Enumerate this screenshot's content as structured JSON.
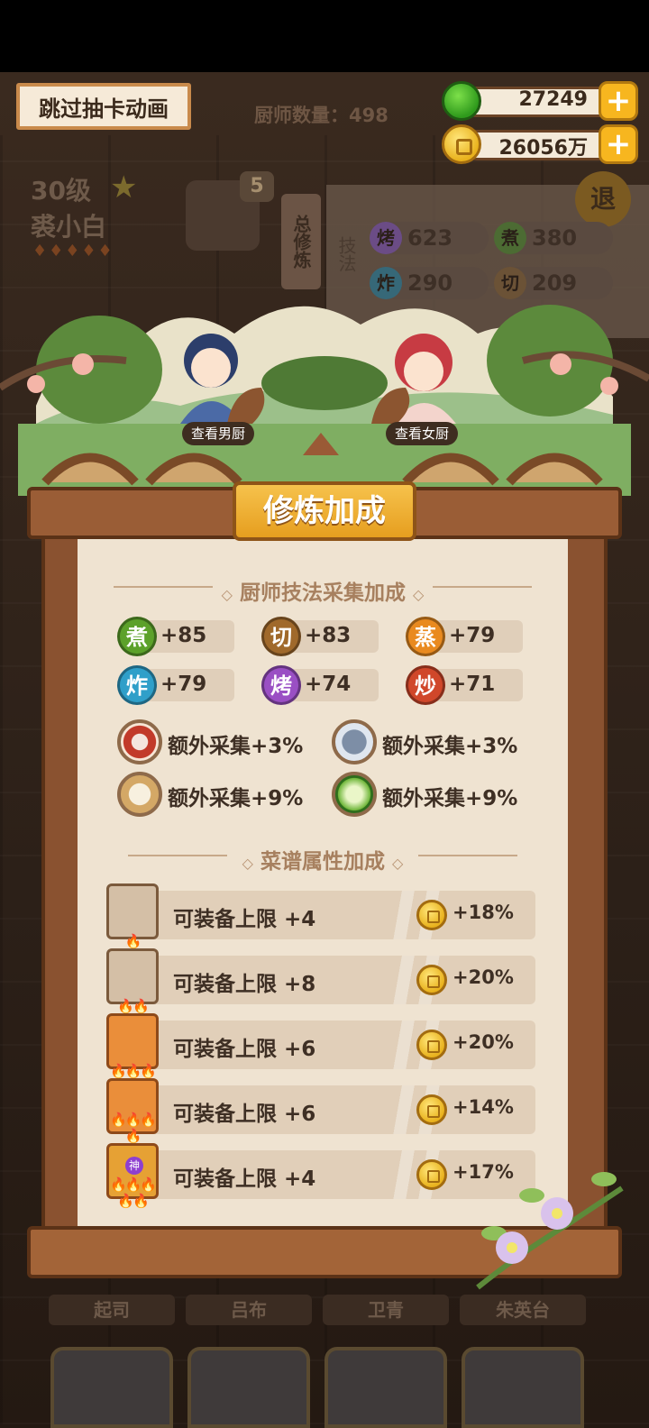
{
  "top": {
    "skip_label": "跳过抽卡动画",
    "chef_count": "厨师数量：498",
    "jade": "27249",
    "coins": "26056万",
    "plus": "+"
  },
  "background": {
    "level": "30级",
    "name": "裘小白",
    "badge": "5",
    "train_label": "总修炼",
    "exit_label": "退",
    "skill_side": "技法",
    "skills": [
      {
        "char": "烤",
        "value": "623"
      },
      {
        "char": "煮",
        "value": "380"
      },
      {
        "char": "炸",
        "value": "290"
      },
      {
        "char": "切",
        "value": "209"
      }
    ],
    "bottom_names": [
      "起司",
      "吕布",
      "卫青",
      "朱英台"
    ]
  },
  "scene": {
    "male_chef_label": "查看男厨",
    "female_chef_label": "查看女厨"
  },
  "board": {
    "title": "修炼加成",
    "skill_section_title": "厨师技法采集加成",
    "skills": [
      {
        "char": "煮",
        "value": "+85",
        "color": "#5ca12a"
      },
      {
        "char": "切",
        "value": "+83",
        "color": "#a0692b"
      },
      {
        "char": "蒸",
        "value": "+79",
        "color": "#e98a1f"
      },
      {
        "char": "炸",
        "value": "+79",
        "color": "#2f9fc9"
      },
      {
        "char": "烤",
        "value": "+74",
        "color": "#9a4fc4"
      },
      {
        "char": "炒",
        "value": "+71",
        "color": "#d0472a"
      }
    ],
    "extras": [
      {
        "icon": "meat-icon",
        "text": "额外采集+3%"
      },
      {
        "icon": "fish-icon",
        "text": "额外采集+3%"
      },
      {
        "icon": "flour-icon",
        "text": "额外采集+9%"
      },
      {
        "icon": "cabbage-icon",
        "text": "额外采集+9%"
      }
    ],
    "recipe_section_title": "菜谱属性加成",
    "recipes": [
      {
        "label": "可装备上限 +4",
        "pct": "+18%",
        "flames": "🔥"
      },
      {
        "label": "可装备上限 +8",
        "pct": "+20%",
        "flames": "🔥🔥"
      },
      {
        "label": "可装备上限 +6",
        "pct": "+20%",
        "flames": "🔥🔥🔥"
      },
      {
        "label": "可装备上限 +6",
        "pct": "+14%",
        "flames": "🔥🔥🔥🔥"
      },
      {
        "label": "可装备上限 +4",
        "pct": "+17%",
        "flames": "🔥🔥🔥🔥🔥",
        "badge": "神"
      }
    ]
  }
}
